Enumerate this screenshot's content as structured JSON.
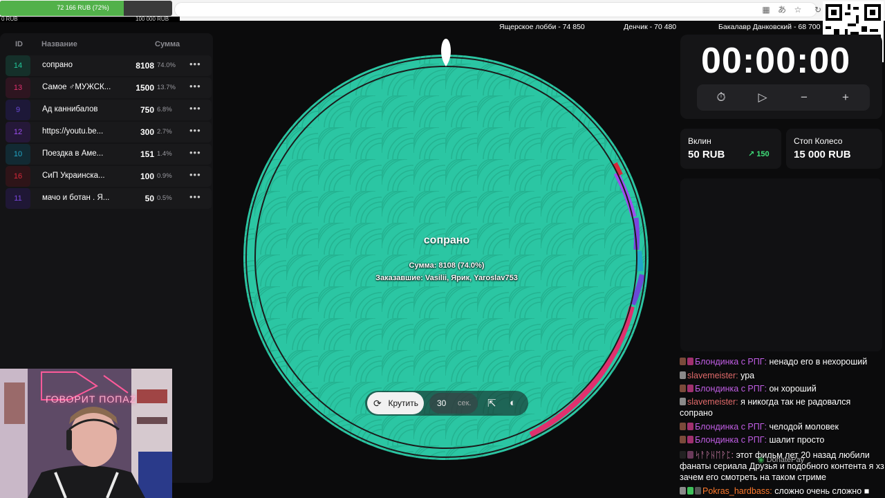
{
  "browser": {
    "progress_label": "72 166 RUB (72%)",
    "progress_fraction": 0.72,
    "under_left": "0 RUB",
    "under_mid": "100 000 RUB"
  },
  "list": {
    "headers": {
      "id": "ID",
      "name": "Название",
      "sum": "Сумма"
    },
    "rows": [
      {
        "id": "14",
        "name": "сопрано",
        "sum": "8108",
        "pct": "74.0%",
        "color": "#22c79a"
      },
      {
        "id": "13",
        "name": "Самое ♂МУЖСК...",
        "sum": "1500",
        "pct": "13.7%",
        "color": "#e0306e"
      },
      {
        "id": "9",
        "name": "Ад каннибалов",
        "sum": "750",
        "pct": "6.8%",
        "color": "#6a4ad8"
      },
      {
        "id": "12",
        "name": "https://youtu.be...",
        "sum": "300",
        "pct": "2.7%",
        "color": "#9d4ef0"
      },
      {
        "id": "10",
        "name": "Поездка в Аме...",
        "sum": "151",
        "pct": "1.4%",
        "color": "#22a7c8"
      },
      {
        "id": "16",
        "name": "СиП Украинска...",
        "sum": "100",
        "pct": "0.9%",
        "color": "#d8283a"
      },
      {
        "id": "11",
        "name": "мачо и ботан . Я...",
        "sum": "50",
        "pct": "0.5%",
        "color": "#7a46e0"
      }
    ]
  },
  "leaders": [
    "Ящерское лобби - 74 850",
    "Денчик - 70 480",
    "Бакалавр Данковский - 68 700"
  ],
  "timer": {
    "value": "00:00:00",
    "icons": [
      "timer-reset-icon",
      "play-icon",
      "minus-icon",
      "plus-icon"
    ]
  },
  "cards": {
    "deposit_label": "Вклин",
    "deposit_value": "50 RUB",
    "deposit_ramp": "150",
    "stop_label": "Стоп Колесо",
    "stop_value": "15 000 RUB"
  },
  "wheel": {
    "title": "сопрано",
    "sum_line": "Сумма: 8108 (74.0%)",
    "orders_line": "Заказавшие: Vasilii, Ярик, Yaroslav753",
    "base_color": "#2bc6a3",
    "spin_label": "Крутить",
    "seconds": "30",
    "seconds_unit": "сек."
  },
  "chat": [
    {
      "user": "Блондинка с РПГ:",
      "text": " ненадо его в нехороший",
      "cls": "u-purple"
    },
    {
      "user": "slavemeister:",
      "text": " ура",
      "cls": "u-red"
    },
    {
      "user": "Блондинка с РПГ:",
      "text": " он хороший",
      "cls": "u-purple"
    },
    {
      "user": "slavemeister:",
      "text": " я никогда так не радовался сопрано",
      "cls": "u-red"
    },
    {
      "user": "Блондинка с РПГ:",
      "text": " челодой моловек",
      "cls": "u-purple"
    },
    {
      "user": "Блондинка с РПГ:",
      "text": " шалит просто",
      "cls": "u-purple"
    },
    {
      "user": "ᛋᚨᚹᚺᛖᚹᛈ:",
      "text": " этот фильм лет 20 назад любили фанаты сериала Друзья и подобного контента я хз зачем его смотреть на таком стриме",
      "cls": "u-pink"
    },
    {
      "user": "Pokras_hardbass:",
      "text": " сложно очень сложно ■",
      "cls": "u-orange"
    }
  ],
  "donatepay": "DonatePay",
  "webcam": {
    "neon_text": "ГОВОРИТ ПОПАZ"
  }
}
